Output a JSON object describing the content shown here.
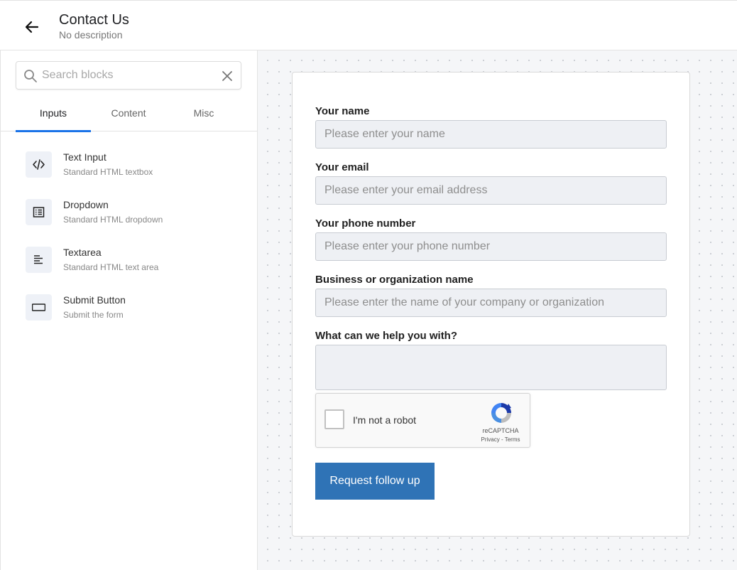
{
  "header": {
    "title": "Contact Us",
    "subtitle": "No description"
  },
  "sidebar": {
    "search_placeholder": "Search blocks",
    "tabs": [
      {
        "label": "Inputs",
        "active": true
      },
      {
        "label": "Content",
        "active": false
      },
      {
        "label": "Misc",
        "active": false
      }
    ],
    "blocks": [
      {
        "name": "Text Input",
        "description": "Standard HTML textbox",
        "icon": "code-icon"
      },
      {
        "name": "Dropdown",
        "description": "Standard HTML dropdown",
        "icon": "list-icon"
      },
      {
        "name": "Textarea",
        "description": "Standard HTML text area",
        "icon": "text-lines-icon"
      },
      {
        "name": "Submit Button",
        "description": "Submit the form",
        "icon": "button-icon"
      }
    ]
  },
  "form": {
    "fields": [
      {
        "label": "Your name",
        "placeholder": "Please enter your name",
        "value": ""
      },
      {
        "label": "Your email",
        "placeholder": "Please enter your email address",
        "value": ""
      },
      {
        "label": "Your phone number",
        "placeholder": "Please enter your phone number",
        "value": ""
      },
      {
        "label": "Business or organization name",
        "placeholder": "Please enter the name of your company or organization",
        "value": ""
      },
      {
        "label": "What can we help you with?",
        "placeholder": "",
        "value": ""
      }
    ],
    "recaptcha": {
      "label": "I'm not a robot",
      "brand": "reCAPTCHA",
      "links": "Privacy - Terms",
      "checked": false
    },
    "submit_label": "Request follow up"
  },
  "colors": {
    "accent": "#1a73e8",
    "submit": "#2f73b6"
  }
}
